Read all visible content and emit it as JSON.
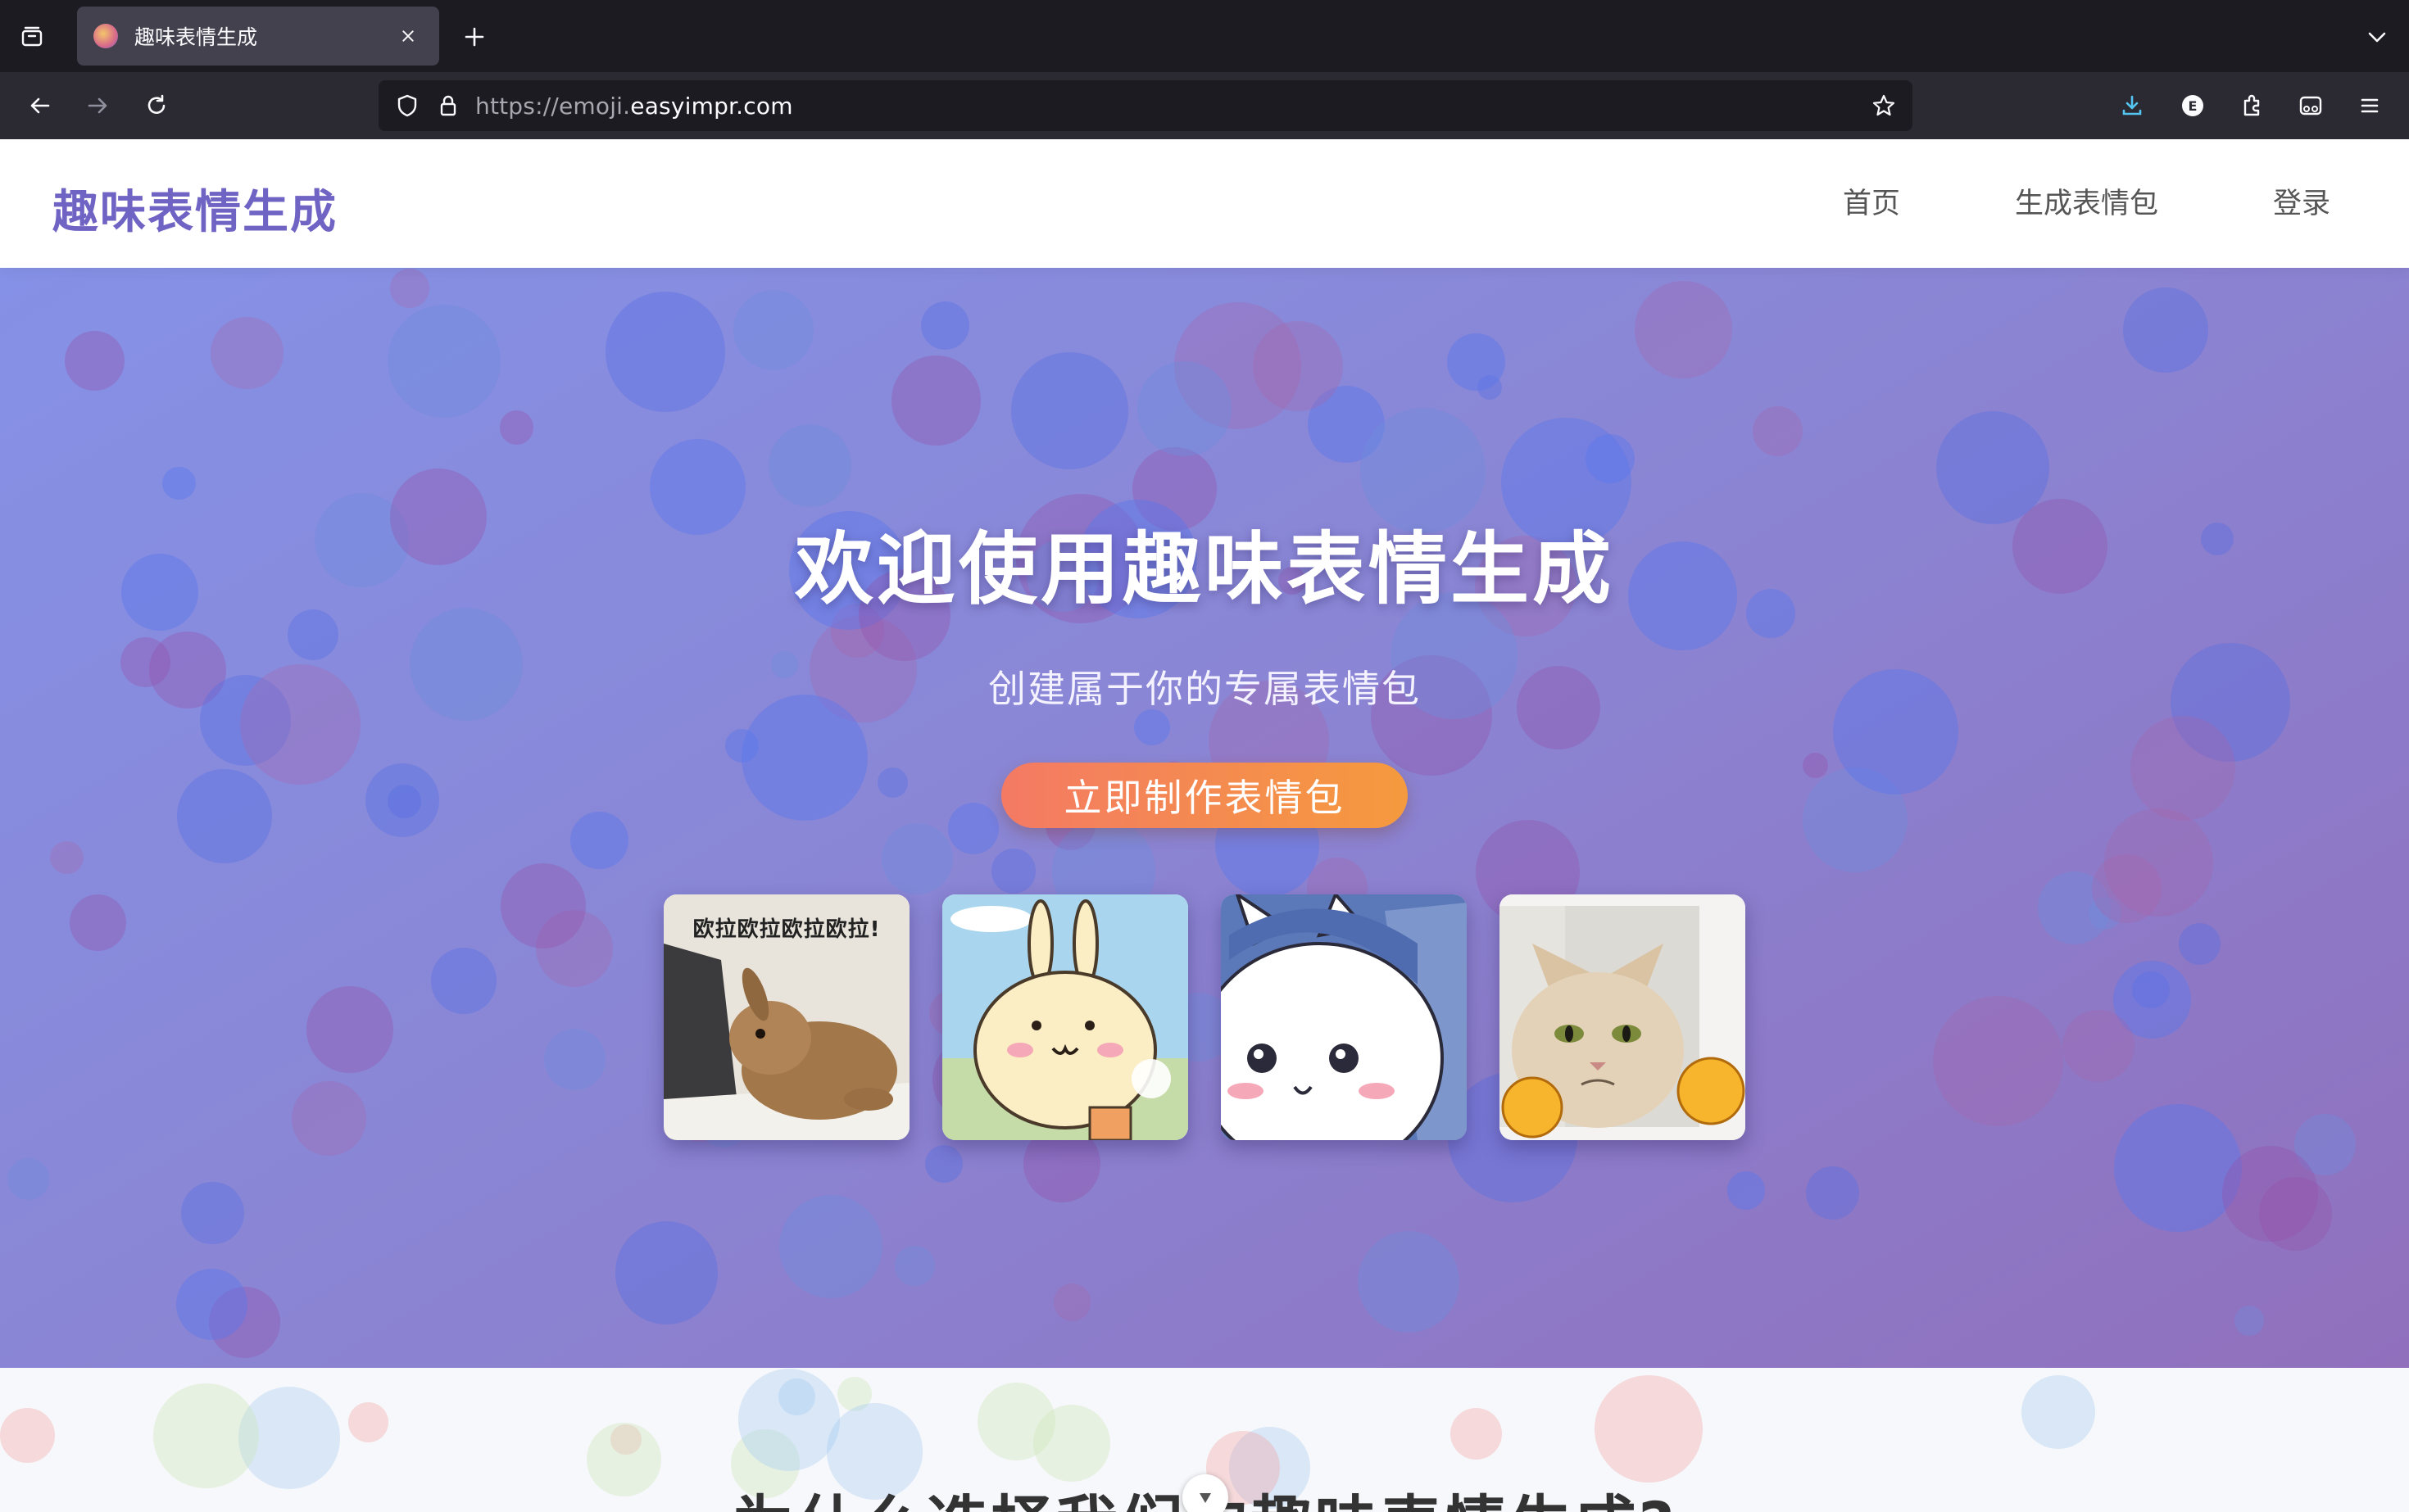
{
  "browser": {
    "tab": {
      "title": "趣味表情生成"
    },
    "url": {
      "scheme": "https://emoji.",
      "domain": "easyimpr.com"
    }
  },
  "site": {
    "logo": "趣味表情生成",
    "nav": [
      {
        "label": "首页"
      },
      {
        "label": "生成表情包"
      },
      {
        "label": "登录"
      }
    ]
  },
  "hero": {
    "title": "欢迎使用趣味表情生成",
    "subtitle": "创建属于你的专属表情包",
    "cta_label": "立即制作表情包",
    "stickers": [
      {
        "caption": "欧拉欧拉欧拉欧拉!",
        "subject": "rabbit"
      },
      {
        "subject": "bunny-cartoon"
      },
      {
        "subject": "white-cat-cartoon"
      },
      {
        "subject": "grumpy-cat"
      }
    ]
  },
  "features": {
    "title": "为什么选择我们的趣味表情生成?"
  },
  "colors": {
    "brand": "#6f63c4",
    "cta_start": "#f47a64",
    "cta_end": "#f59a3e"
  }
}
